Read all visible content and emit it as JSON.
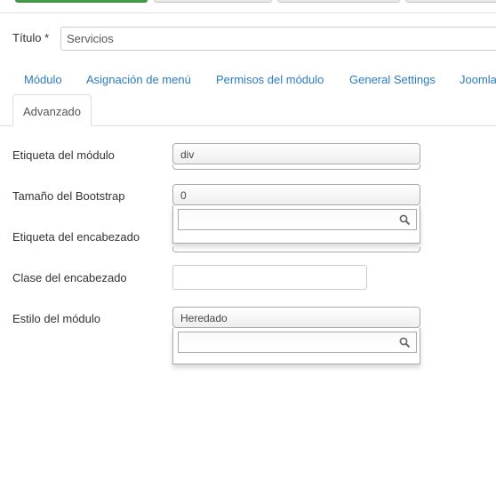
{
  "form": {
    "title_label": "Título *",
    "title_value": "Servicios"
  },
  "tabs": [
    {
      "label": "Módulo"
    },
    {
      "label": "Asignación de menú"
    },
    {
      "label": "Permisos del módulo"
    },
    {
      "label": "General Settings"
    },
    {
      "label": "Joomla"
    }
  ],
  "active_tab": {
    "label": "Advanzado"
  },
  "fields": {
    "module_tag": {
      "label": "Etiqueta del módulo",
      "value": "div"
    },
    "bootstrap_size": {
      "label": "Tamaño del Bootstrap",
      "value": "0"
    },
    "header_tag": {
      "label": "Etiqueta del encabezado"
    },
    "header_class": {
      "label": "Clase del encabezado",
      "value": ""
    },
    "module_style": {
      "label": "Estilo del módulo",
      "value": "Heredado"
    }
  },
  "colors": {
    "link": "#2a7bbf",
    "primary_button": "#4cae4c"
  }
}
